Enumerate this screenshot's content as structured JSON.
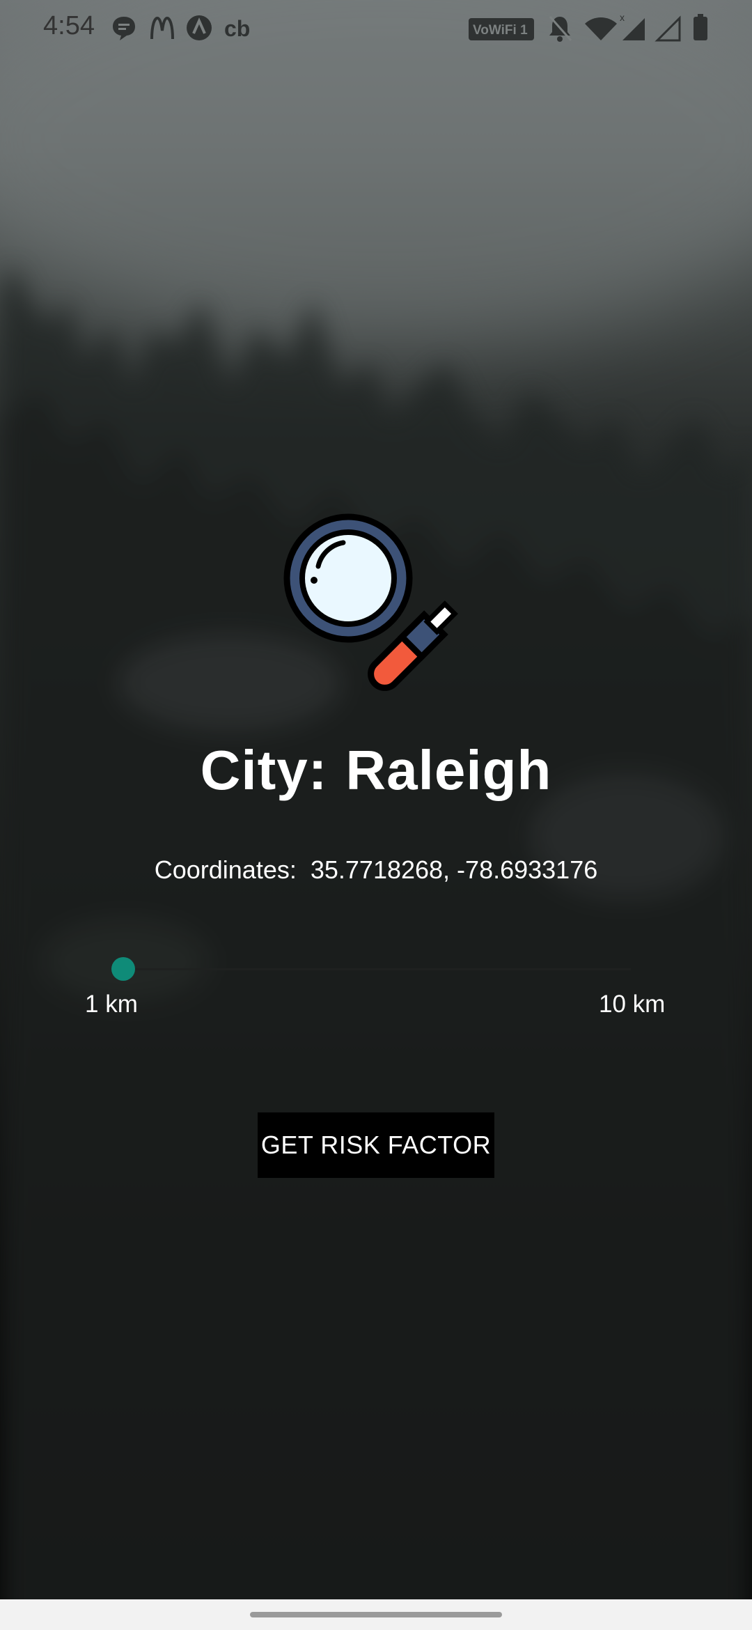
{
  "status_bar": {
    "time": "4:54",
    "left_icons": [
      "chat-bubble-icon",
      "mcdonalds-icon",
      "arc-logo-icon",
      "coinbase-icon"
    ],
    "right_icons": [
      "vowifi-icon",
      "bell-off-icon",
      "wifi-icon",
      "signal-x-icon",
      "signal-empty-icon",
      "battery-icon"
    ],
    "vowifi_label": "VoWiFi 1",
    "cb_label": "cb"
  },
  "main": {
    "illustration": "magnifying-glass-icon",
    "city_label": "City:",
    "city_value": "Raleigh",
    "coordinates_label": "Coordinates:",
    "coordinates_value": "35.7718268, -78.6933176"
  },
  "slider": {
    "min_label": "1 km",
    "max_label": "10 km",
    "value_fraction": 0,
    "thumb_color": "#0f8b78"
  },
  "actions": {
    "get_risk_label": "GET RISK FACTOR"
  },
  "colors": {
    "accent": "#0f8b78",
    "button_bg": "#000000",
    "text": "#ffffff"
  }
}
